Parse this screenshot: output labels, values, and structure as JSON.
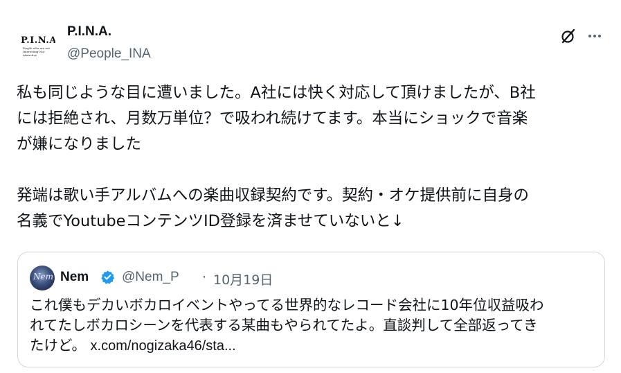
{
  "author": {
    "avatar_text": "P.I.N.A.",
    "avatar_subtext": "People who are not Interesting Nor Attractive",
    "display_name": "P.I.N.A.",
    "handle": "@People_INA"
  },
  "icons": {
    "grok": "grok-icon",
    "more": "more-icon",
    "verified": "verified-badge-icon",
    "verified_color": "#1d9bf0"
  },
  "tweet": {
    "lines": [
      "私も同じような目に遭いました。A社には快く対応して頂けましたが、B社",
      "には拒絶され、月数万単位？で吸われ続けてます。本当にショックで音楽",
      "が嫌になりました",
      "",
      "発端は歌い手アルバムへの楽曲収録契約です。契約・オケ提供前に自身の",
      "名義でYoutubeコンテンツID登録を済ませていないと↓"
    ]
  },
  "quote": {
    "avatar_text": "Nem",
    "display_name": "Nem",
    "handle": "@Nem_P",
    "separator": "·",
    "date": "10月19日",
    "lines": [
      "これ僕もデカいボカロイベントやってる世界的なレコード会社に10年位収益吸わ",
      "れてたしボカロシーンを代表する某曲もやられてたよ。直談判して全部返ってき",
      "たけど。"
    ],
    "link": "x.com/nogizaka46/sta..."
  }
}
